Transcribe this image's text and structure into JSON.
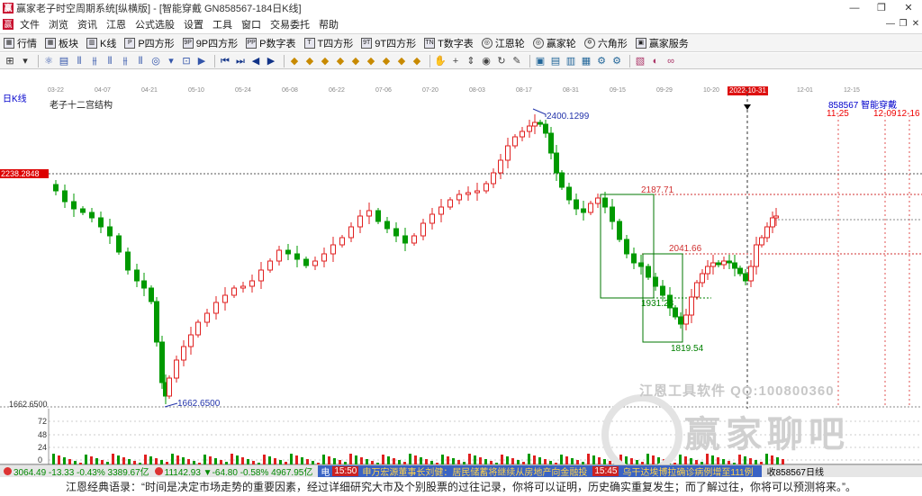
{
  "window": {
    "title": "赢家老子时空周期系统[纵横版] - [智能穿戴  GN858567-184日K线]",
    "app_icon_glyph": "赢",
    "controls": [
      "—",
      "❐",
      "✕"
    ]
  },
  "menubar": {
    "icon_glyph": "赢",
    "items": [
      "文件",
      "浏览",
      "资讯",
      "江恩",
      "公式选股",
      "设置",
      "工具",
      "窗口",
      "交易委托",
      "帮助"
    ],
    "mdi_controls": [
      "—",
      "❐",
      "✕"
    ]
  },
  "toolbar1": {
    "items": [
      {
        "icon": "▦",
        "label": "行情"
      },
      {
        "icon": "▦",
        "label": "板块"
      },
      {
        "icon": "▥",
        "label": "K线"
      },
      {
        "icon": "P",
        "label": "P四方形"
      },
      {
        "icon": "9P",
        "label": "9P四方形"
      },
      {
        "icon": "PP",
        "label": "P数字表"
      },
      {
        "icon": "T",
        "label": "T四方形"
      },
      {
        "icon": "9T",
        "label": "9T四方形"
      },
      {
        "icon": "TN",
        "label": "T数字表"
      },
      {
        "icon": "◎",
        "label": "江恩轮",
        "round": true
      },
      {
        "icon": "◎",
        "label": "赢家轮",
        "round": true
      },
      {
        "icon": "✡",
        "label": "六角形",
        "round": true
      },
      {
        "icon": "▣",
        "label": "赢家服务"
      }
    ]
  },
  "toolbar2": {
    "groups": [
      [
        "⊞",
        "▾"
      ],
      [
        "⚛",
        "▤",
        "⫴",
        "⫵",
        "⫴",
        "⫵",
        "⫴",
        "◎",
        "▾",
        "⊡",
        "▶"
      ],
      [
        "⏮",
        "⏭",
        "◀",
        "▶"
      ],
      [
        "◆",
        "◆",
        "◆",
        "◆",
        "◆",
        "◆",
        "◆",
        "◆",
        "◆"
      ],
      [
        "✋",
        "+",
        "⇕",
        "◉",
        "↻",
        "✎"
      ],
      [
        "▣",
        "▤",
        "▥",
        "▦",
        "⚙",
        "⚙"
      ],
      [
        "▧",
        "◐",
        "∞"
      ]
    ]
  },
  "chart": {
    "period_label": "日K线",
    "structure_label": "老子十二宫结构",
    "code_label": "858567  智能穿戴",
    "current_price_box": "2238.2848",
    "high_label": "2400.1299",
    "low_label": "1662.6500",
    "level1": "2187.71",
    "level2": "2041.66",
    "level3": "1931.28",
    "level4": "1819.54",
    "low_axis_label": "1662.6500",
    "date_marks": [
      "11-25",
      "12-09",
      "12-16"
    ],
    "date_axis": [
      "03-22",
      "04-07",
      "04-21",
      "05-10",
      "05-24",
      "06-08",
      "06-22",
      "07-06",
      "07-20",
      "08-03",
      "08-17",
      "08-31",
      "09-15",
      "09-29",
      "10-20",
      "11-17",
      "12-01",
      "12-15"
    ],
    "current_date": "2022-10-31",
    "colors": {
      "up": "#e02020",
      "down": "#009900",
      "level": "#d03030",
      "box": "#008000",
      "label_blue": "#2233aa"
    }
  },
  "histogram": {
    "axis_labels": [
      "72",
      "48",
      "24",
      "0"
    ]
  },
  "watermark": {
    "line1": "江恩工具软件  QQ:100800360",
    "line2": "赢家聊吧"
  },
  "statusbar": {
    "idx1": "3064.49  -13.33  -0.43%  3389.67亿",
    "idx2": "11142.93  ▼-64.80  -0.58%  4967.95亿",
    "news_prefix": "电",
    "news1_time": "15:50",
    "news1": "申万宏源董事长刘健：居民储蓄将继续从房地产向金融投",
    "news2_time": "15:45",
    "news2": "乌干达埃博拉确诊病例增至111例",
    "right": "收858567日线"
  },
  "bottom_quote": "江恩经典语录：“时间是决定市场走势的重要因素，经过详细研究大市及个别股票的过往记录，你将可以证明，历史确实重复发生；而了解过往，你将可以预测将来。”。"
}
